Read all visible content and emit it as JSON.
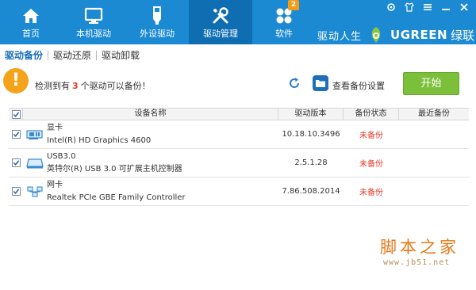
{
  "nav": {
    "items": [
      {
        "label": "首页",
        "icon": "home-icon"
      },
      {
        "label": "本机驱动",
        "icon": "monitor-icon"
      },
      {
        "label": "外设驱动",
        "icon": "usb-icon"
      },
      {
        "label": "驱动管理",
        "icon": "wrench-icon",
        "active": true
      },
      {
        "label": "软件",
        "icon": "apps-icon",
        "badge": "2"
      }
    ]
  },
  "brand": {
    "text1": "驱动人生",
    "text2": "UGREEN",
    "text3": "绿联"
  },
  "window_controls": [
    "settings-icon",
    "shirt-icon",
    "menu-icon",
    "minimize-icon",
    "close-icon"
  ],
  "subtabs": [
    {
      "label": "驱动备份",
      "active": true
    },
    {
      "label": "驱动还原"
    },
    {
      "label": "驱动卸载"
    }
  ],
  "info": {
    "prefix": "检测到有",
    "count": "3",
    "suffix": "个驱动可以备份！",
    "view_settings": "查看备份设置",
    "start_button": "开始"
  },
  "table": {
    "headers": {
      "name": "设备名称",
      "version": "驱动版本",
      "status": "备份状态",
      "last": "最近备份"
    },
    "rows": [
      {
        "category": "显卡",
        "device": "Intel(R) HD Graphics 4600",
        "version": "10.18.10.3496",
        "status": "未备份",
        "last": "",
        "icon": "graphics-card-icon"
      },
      {
        "category": "USB3.0",
        "device": "英特尔(R) USB 3.0 可扩展主机控制器",
        "version": "2.5.1.28",
        "status": "未备份",
        "last": "",
        "icon": "usb-controller-icon"
      },
      {
        "category": "网卡",
        "device": "Realtek PCIe GBE Family Controller",
        "version": "7.86.508.2014",
        "status": "未备份",
        "last": "",
        "icon": "network-card-icon"
      }
    ]
  },
  "watermark": {
    "cn": "脚本之家",
    "url": "www.jb51.net"
  },
  "colors": {
    "header": "#1b8ad3",
    "header_active": "#0f6db2",
    "start_button": "#7bbf3a",
    "warning": "#f5a31a",
    "status_red": "#e53a2a"
  }
}
